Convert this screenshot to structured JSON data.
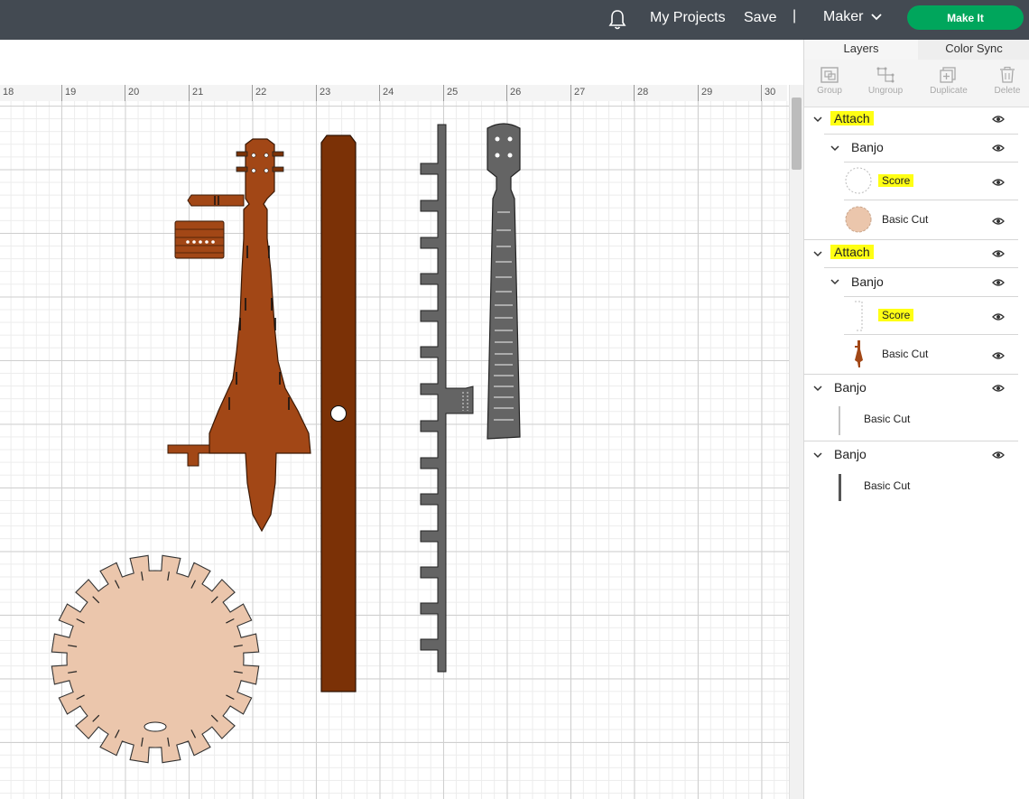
{
  "topbar": {
    "my_projects": "My Projects",
    "save": "Save",
    "separator": "|",
    "machine": "Maker",
    "make_it": "Make It"
  },
  "ruler": {
    "ticks": [
      "18",
      "19",
      "20",
      "21",
      "22",
      "23",
      "24",
      "25",
      "26",
      "27",
      "28",
      "29",
      "30"
    ]
  },
  "panel": {
    "tabs": [
      "Layers",
      "Color Sync"
    ],
    "tools": [
      "Group",
      "Ungroup",
      "Duplicate",
      "Delete"
    ],
    "layers": {
      "group1": {
        "name": "Attach",
        "sub": "Banjo",
        "items": [
          "Score",
          "Basic Cut"
        ]
      },
      "group2": {
        "name": "Attach",
        "sub": "Banjo",
        "items": [
          "Score",
          "Basic Cut"
        ]
      },
      "group3": {
        "name": "Banjo",
        "item": "Basic Cut"
      },
      "group4": {
        "name": "Banjo",
        "item": "Basic Cut"
      }
    }
  },
  "colors": {
    "topbar": "#434a52",
    "make_it": "#00a65c",
    "banjo_brown": "#7a3208",
    "neck_brown": "#a24716",
    "rod_brown": "#7b3106",
    "fret_gray": "#646464",
    "head_skin": "#ebc6ac",
    "highlight": "#ffff14"
  }
}
